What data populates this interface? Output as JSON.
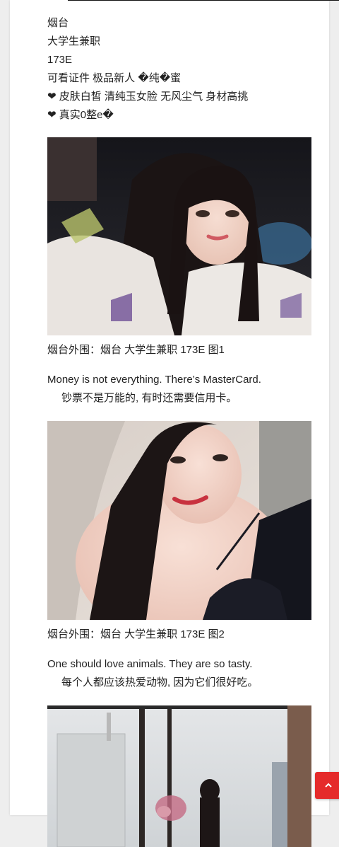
{
  "intro": {
    "lines": [
      "烟台",
      "大学生兼职",
      "173E",
      "可看证件 极品新人 �纯�蜜",
      "❤ 皮肤白皙 清纯玉女脸 无风尘气 身材高挑",
      "❤ 真实0整e�"
    ]
  },
  "posts": [
    {
      "caption": "烟台外围：烟台 大学生兼职 173E 图1",
      "quote_en": "Money is not everything. There’s MasterCard.",
      "quote_cn": "钞票不是万能的, 有时还需要信用卡。"
    },
    {
      "caption": "烟台外围：烟台 大学生兼职 173E 图2",
      "quote_en": "One should love animals. They are so tasty.",
      "quote_cn": "每个人都应该热爱动物, 因为它们很好吃。"
    }
  ],
  "back_to_top": {
    "icon": "chevron-up-icon",
    "color": "#e52b2b"
  }
}
